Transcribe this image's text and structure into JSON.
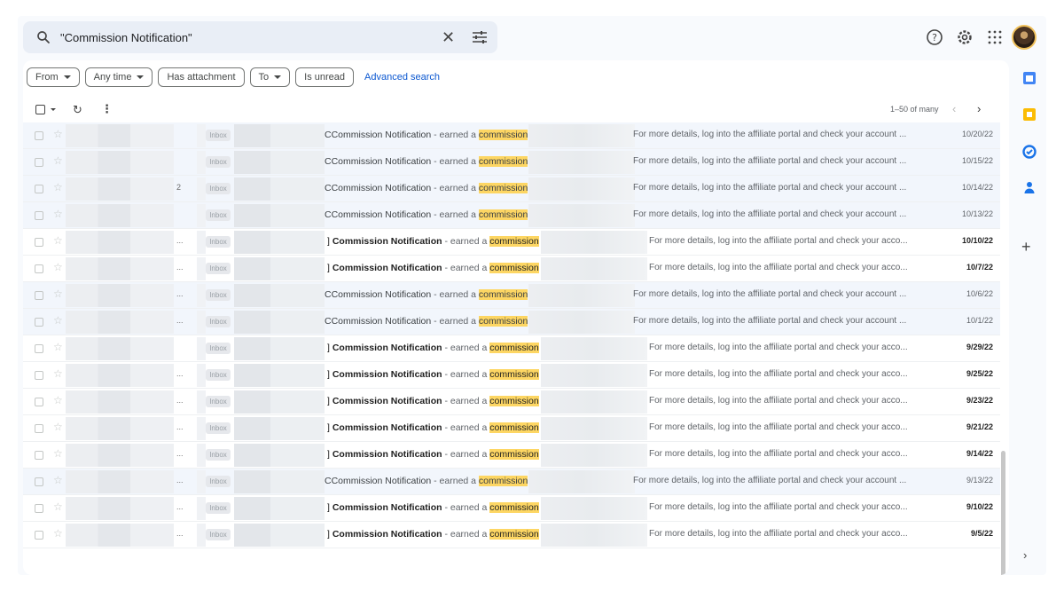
{
  "search": {
    "query": "\"Commission Notification\""
  },
  "filters": [
    {
      "label": "From",
      "dropdown": true
    },
    {
      "label": "Any time",
      "dropdown": true
    },
    {
      "label": "Has attachment",
      "dropdown": false
    },
    {
      "label": "To",
      "dropdown": true
    },
    {
      "label": "Is unread",
      "dropdown": false
    }
  ],
  "advanced_search": "Advanced search",
  "toolbar": {
    "range": "1–50 of many"
  },
  "label_text": "Inbox",
  "subject_main": "Commission Notification",
  "subject_sep": " - earned a ",
  "subject_kw": "commission",
  "snippet_full": "For more details, log into the affiliate portal and check your account ...",
  "snippet_short": "For more details, log into the affiliate portal and check your acco...",
  "colors": {
    "highlight": "#fdd663",
    "link": "#0b57d0",
    "read_row": "#f2f6fc"
  },
  "icons": [
    "search-icon",
    "close-icon",
    "tune-icon",
    "help-icon",
    "gear-icon",
    "apps-icon",
    "calendar-icon",
    "keep-icon",
    "tasks-icon",
    "contacts-icon",
    "plus-icon"
  ],
  "rows": [
    {
      "read": true,
      "prefix": "C",
      "count": "",
      "date": "10/20/22"
    },
    {
      "read": true,
      "prefix": "C",
      "count": "",
      "date": "10/15/22"
    },
    {
      "read": true,
      "prefix": "C",
      "count": "2",
      "date": "10/14/22"
    },
    {
      "read": true,
      "prefix": "C",
      "count": "",
      "date": "10/13/22"
    },
    {
      "read": false,
      "prefix": "] ",
      "count": "...",
      "date": "10/10/22"
    },
    {
      "read": false,
      "prefix": "] ",
      "count": "...",
      "date": "10/7/22"
    },
    {
      "read": true,
      "prefix": "C",
      "count": "...",
      "date": "10/6/22"
    },
    {
      "read": true,
      "prefix": "C",
      "count": "...",
      "date": "10/1/22"
    },
    {
      "read": false,
      "prefix": "] ",
      "count": "",
      "date": "9/29/22"
    },
    {
      "read": false,
      "prefix": "] ",
      "count": "...",
      "date": "9/25/22"
    },
    {
      "read": false,
      "prefix": "] ",
      "count": "...",
      "date": "9/23/22"
    },
    {
      "read": false,
      "prefix": "] ",
      "count": "...",
      "date": "9/21/22"
    },
    {
      "read": false,
      "prefix": "] ",
      "count": "...",
      "date": "9/14/22"
    },
    {
      "read": true,
      "prefix": "C",
      "count": "...",
      "date": "9/13/22"
    },
    {
      "read": false,
      "prefix": "] ",
      "count": "...",
      "date": "9/10/22"
    },
    {
      "read": false,
      "prefix": "] ",
      "count": "...",
      "date": "9/5/22"
    }
  ]
}
